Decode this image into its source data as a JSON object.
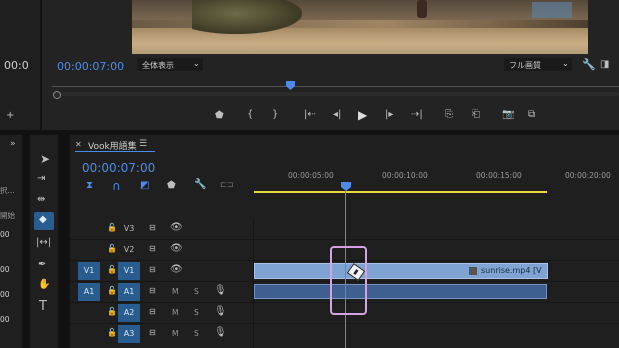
{
  "left_panel": {
    "timecode_partial": "00:0",
    "labels": [
      "択...",
      "開始",
      "00",
      "00",
      "00",
      "00"
    ]
  },
  "monitor": {
    "timecode": "00:00:07:00",
    "zoom_select": "全体表示",
    "quality_select": "フル画質"
  },
  "timeline": {
    "sequence_tab": "Vook用語集",
    "timecode": "00:00:07:00",
    "ruler_ticks": [
      "00:00:05:00",
      "00:00:10:00",
      "00:00:15:00",
      "00:00:20:00"
    ],
    "tracks": {
      "video": [
        {
          "target": "",
          "name": "V3",
          "selected": false
        },
        {
          "target": "",
          "name": "V2",
          "selected": false
        },
        {
          "target": "V1",
          "name": "V1",
          "selected": true
        }
      ],
      "audio": [
        {
          "target": "A1",
          "name": "A1",
          "m": "M",
          "s": "S",
          "selected": true
        },
        {
          "target": "",
          "name": "A2",
          "m": "M",
          "s": "S",
          "selected": true
        },
        {
          "target": "",
          "name": "A3",
          "m": "M",
          "s": "S",
          "selected": true
        }
      ]
    },
    "clip_name": "sunrise.mp4 [V",
    "colors": {
      "accent": "#4c8ce8",
      "clip_video": "#7fa4d4",
      "clip_audio": "#3e5f8f",
      "work_area": "#e8d83a",
      "highlight": "#d7a2e3"
    }
  },
  "icons": {
    "monitor_transport": [
      "marker-icon",
      "mark-in-icon",
      "mark-out-icon",
      "go-to-in-icon",
      "step-back-icon",
      "play-icon",
      "step-forward-icon",
      "go-to-out-icon",
      "insert-icon",
      "overwrite-icon",
      "export-frame-icon",
      "button-editor-icon"
    ],
    "tools": [
      "selection-tool-icon",
      "track-select-icon",
      "ripple-edit-icon",
      "razor-tool-icon",
      "slip-tool-icon",
      "pen-tool-icon",
      "hand-tool-icon",
      "type-tool-icon"
    ],
    "timeline_toolbar": [
      "nest-icon",
      "snap-icon",
      "linked-selection-icon",
      "add-marker-icon",
      "settings-icon",
      "captions-icon"
    ]
  }
}
